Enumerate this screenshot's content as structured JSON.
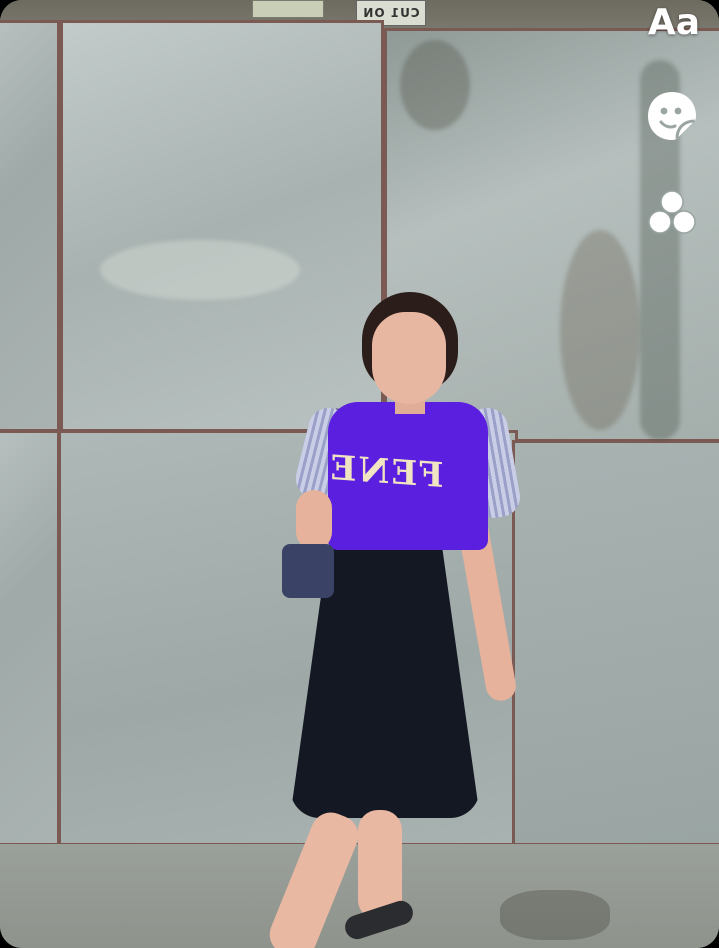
{
  "photo": {
    "subject": "",
    "sign_text": "CU1 ON",
    "shirt_text": "FENE"
  },
  "editor_tools": {
    "text_label": "Aa",
    "sticker_icon": "sticker-icon",
    "effects_icon": "effects-icon"
  },
  "colors": {
    "icon": "#ffffff",
    "shirt": "#5b1fe0",
    "skirt": "#141822"
  }
}
